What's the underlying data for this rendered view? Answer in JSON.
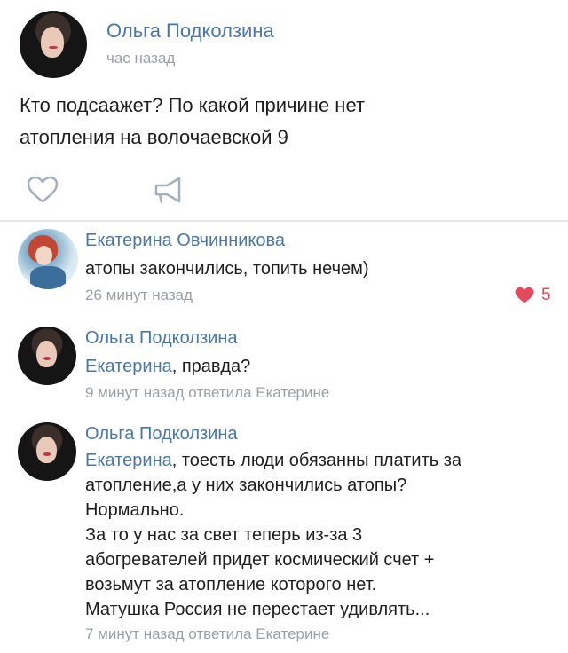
{
  "post": {
    "author": "Ольга Подколзина",
    "time": "час назад",
    "text_line1": "Кто подсаажет? По какой причине нет",
    "text_line2": "атопления на волочаевской 9"
  },
  "comments": [
    {
      "author": "Екатерина Овчинникова",
      "text": "атопы закончились, топить нечем)",
      "time": "26 минут назад",
      "likes": "5"
    },
    {
      "author": "Ольга Подколзина",
      "reply_to": "Екатерина",
      "text": ", правда?",
      "time": "9 минут назад ответила Екатерине"
    },
    {
      "author": "Ольга Подколзина",
      "reply_to": "Екатерина",
      "line1": ", тоесть люди обязанны платить за",
      "line2": "атопление,а у них закончились атопы?",
      "line3": "Нормально.",
      "line4": "За то у нас за свет теперь из-за 3",
      "line5": "абогревателей придет космический счет +",
      "line6": "возьмут за атопление которого нет.",
      "line7": "Матушка Россия не перестает удивлять...",
      "time": "7 минут назад ответила Екатерине"
    }
  ],
  "icons": {
    "like": "heart-outline-icon",
    "share": "megaphone-icon",
    "liked": "heart-filled-icon"
  },
  "colors": {
    "name": "#4a76a8",
    "meta": "#9aa0a6",
    "like_red": "#e44a5b"
  }
}
